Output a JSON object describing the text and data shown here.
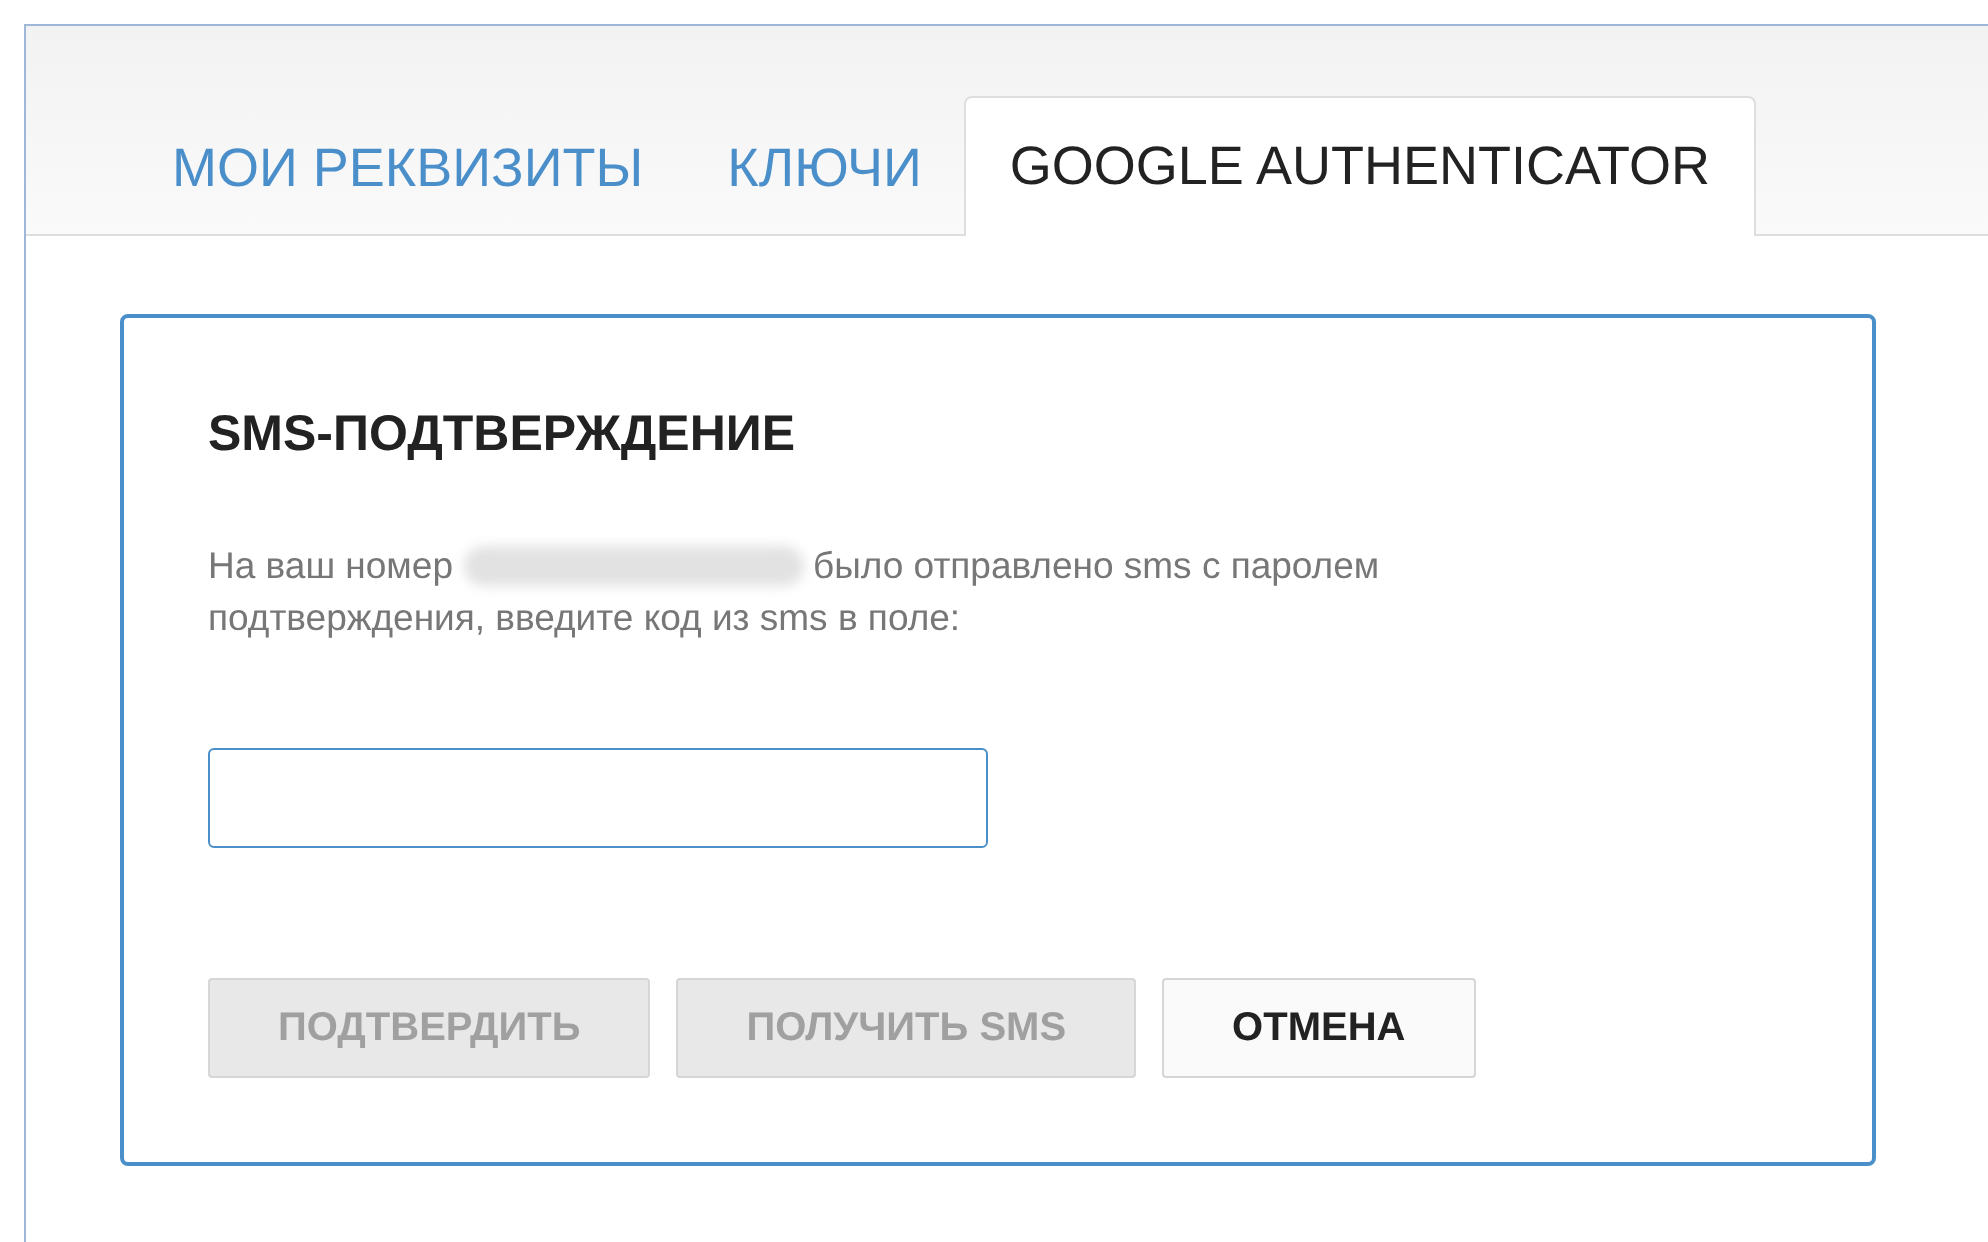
{
  "tabs": [
    {
      "label": "МОИ РЕКВИЗИТЫ",
      "selected": false
    },
    {
      "label": "КЛЮЧИ",
      "selected": false
    },
    {
      "label": "GOOGLE AUTHENTICATOR",
      "selected": true
    }
  ],
  "card": {
    "title": "SMS-ПОДТВЕРЖДЕНИЕ",
    "message_lead": "На ваш номер",
    "message_lines": [
      "было отправлено sms с паролем",
      "подтверждения, введите код из sms в поле:"
    ],
    "buttons": [
      {
        "label": "ПОДТВЕРДИТЬ",
        "disabled": true
      },
      {
        "label": "ПОЛУЧИТЬ SMS",
        "disabled": true
      },
      {
        "label": "ОТМЕНА",
        "disabled": false
      }
    ]
  }
}
